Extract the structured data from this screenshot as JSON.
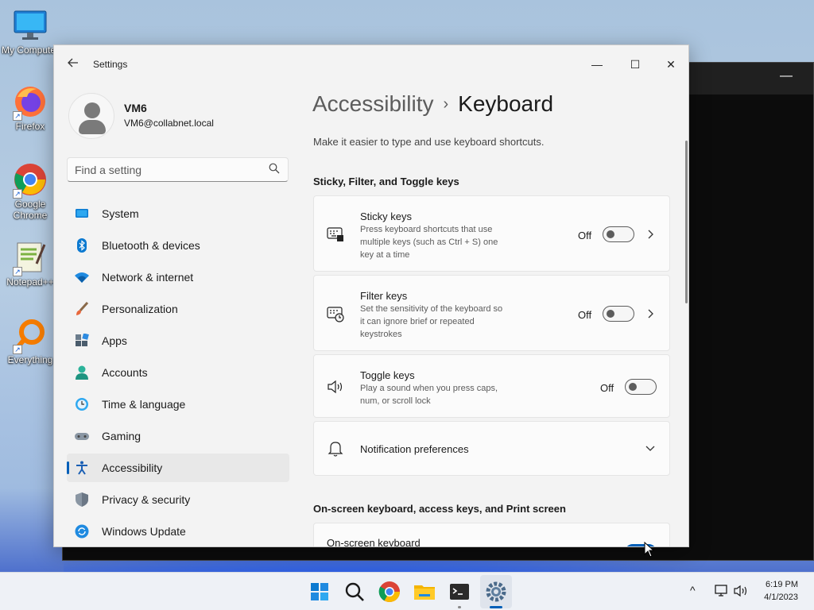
{
  "desktop": {
    "icons": [
      {
        "label": "My Computer",
        "icon": "monitor-icon"
      },
      {
        "label": "Firefox",
        "icon": "firefox-icon"
      },
      {
        "label": "Google Chrome",
        "icon": "chrome-icon"
      },
      {
        "label": "Notepad++",
        "icon": "notepadpp-icon"
      },
      {
        "label": "Everything",
        "icon": "everything-icon"
      }
    ]
  },
  "window": {
    "title": "Settings",
    "controls": {
      "minimize": "—",
      "maximize": "☐",
      "close": "✕"
    }
  },
  "user": {
    "name": "VM6",
    "email": "VM6@collabnet.local"
  },
  "search": {
    "placeholder": "Find a setting"
  },
  "sidebar": {
    "items": [
      {
        "label": "System",
        "icon": "system-icon"
      },
      {
        "label": "Bluetooth & devices",
        "icon": "bluetooth-icon"
      },
      {
        "label": "Network & internet",
        "icon": "network-icon"
      },
      {
        "label": "Personalization",
        "icon": "brush-icon"
      },
      {
        "label": "Apps",
        "icon": "apps-icon"
      },
      {
        "label": "Accounts",
        "icon": "accounts-icon"
      },
      {
        "label": "Time & language",
        "icon": "clock-icon"
      },
      {
        "label": "Gaming",
        "icon": "gamepad-icon"
      },
      {
        "label": "Accessibility",
        "icon": "accessibility-icon",
        "active": true
      },
      {
        "label": "Privacy & security",
        "icon": "shield-icon"
      },
      {
        "label": "Windows Update",
        "icon": "update-icon"
      }
    ]
  },
  "main": {
    "breadcrumb": {
      "parent": "Accessibility",
      "separator": "›",
      "current": "Keyboard"
    },
    "description": "Make it easier to type and use keyboard shortcuts.",
    "section1": "Sticky, Filter, and Toggle keys",
    "cards": {
      "sticky": {
        "title": "Sticky keys",
        "desc": "Press keyboard shortcuts that use multiple keys (such as Ctrl + S) one key at a time",
        "state": "Off",
        "icon": "sticky-keys-icon"
      },
      "filter": {
        "title": "Filter keys",
        "desc": "Set the sensitivity of the keyboard so it can ignore brief or repeated keystrokes",
        "state": "Off",
        "icon": "filter-keys-icon"
      },
      "toggle": {
        "title": "Toggle keys",
        "desc": "Play a sound when you press caps, num, or scroll lock",
        "state": "Off",
        "icon": "speaker-icon"
      },
      "notifications": {
        "title": "Notification preferences",
        "icon": "bell-icon"
      }
    },
    "section2": "On-screen keyboard, access keys, and Print screen",
    "osk": {
      "title": "On-screen keyboard"
    }
  },
  "taskbar": {
    "apps": [
      "start-icon",
      "search-icon",
      "chrome-icon",
      "file-explorer-icon",
      "terminal-icon",
      "settings-icon"
    ],
    "time": "6:19 PM",
    "date": "4/1/2023",
    "tray_chevron": "^"
  },
  "colors": {
    "accent": "#005fb8",
    "window_bg": "#f3f3f3",
    "card_bg": "#fbfbfb"
  }
}
